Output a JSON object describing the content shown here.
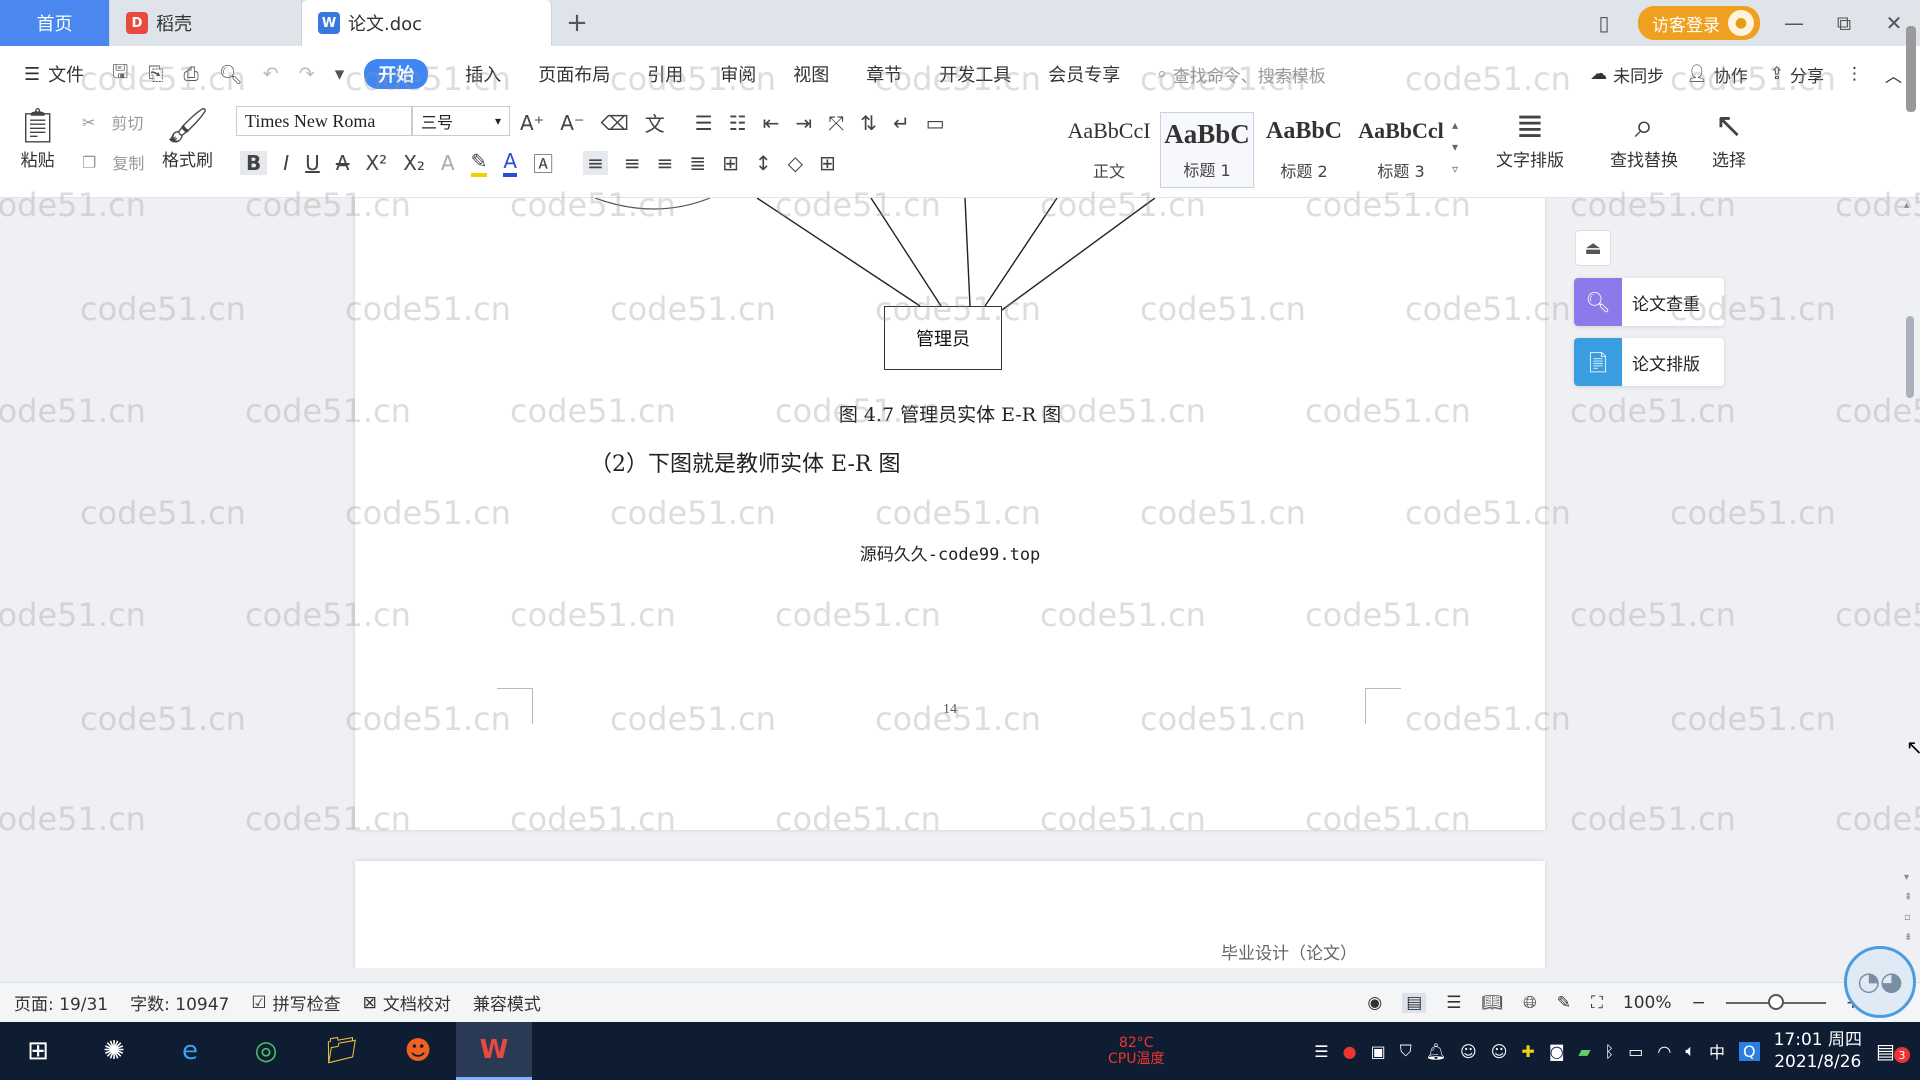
{
  "tabs": {
    "home": "首页",
    "daoke": "稻壳",
    "doc": "论文.doc",
    "add": "+"
  },
  "titlebar": {
    "login": "访客登录",
    "minimize": "—",
    "restore": "⧉",
    "close": "✕"
  },
  "menu": {
    "file": "文件",
    "items": [
      "开始",
      "插入",
      "页面布局",
      "引用",
      "审阅",
      "视图",
      "章节",
      "开发工具",
      "会员专享"
    ],
    "search_placeholder": "查找命令、搜索模板",
    "sync": "未同步",
    "collab": "协作",
    "share": "分享"
  },
  "ribbon": {
    "paste": "粘贴",
    "cut": "剪切",
    "copy": "复制",
    "format_painter": "格式刷",
    "font_name": "Times New Roma",
    "font_size": "三号",
    "styles": [
      {
        "preview": "AaBbCcI",
        "name": "正文"
      },
      {
        "preview": "AaBbC",
        "name": "标题 1"
      },
      {
        "preview": "AaBbC",
        "name": "标题 2"
      },
      {
        "preview": "AaBbCcl",
        "name": "标题 3"
      }
    ],
    "text_layout": "文字排版",
    "find_replace": "查找替换",
    "select": "选择"
  },
  "document": {
    "entity_label": "管理员",
    "figure_caption": "图 4.7  管理员实体 E-R 图",
    "paragraph": "（2）下图就是教师实体 E-R 图",
    "source_mark": "源码久久-code99.top",
    "page_number": "14",
    "next_page_header": "毕业设计（论文）"
  },
  "side_panel": {
    "check": "论文查重",
    "layout": "论文排版"
  },
  "status": {
    "page": "页面: 19/31",
    "words": "字数: 10947",
    "spell": "拼写检查",
    "proof": "文档校对",
    "compat": "兼容模式",
    "zoom": "100%",
    "zoom_level": 0.5
  },
  "taskbar": {
    "cpu_temp": "82°C",
    "cpu_label": "CPU温度",
    "time": "17:01 周四",
    "date": "2021/8/26",
    "ime": "中",
    "notif_count": "3"
  },
  "watermark": "code51.cn"
}
